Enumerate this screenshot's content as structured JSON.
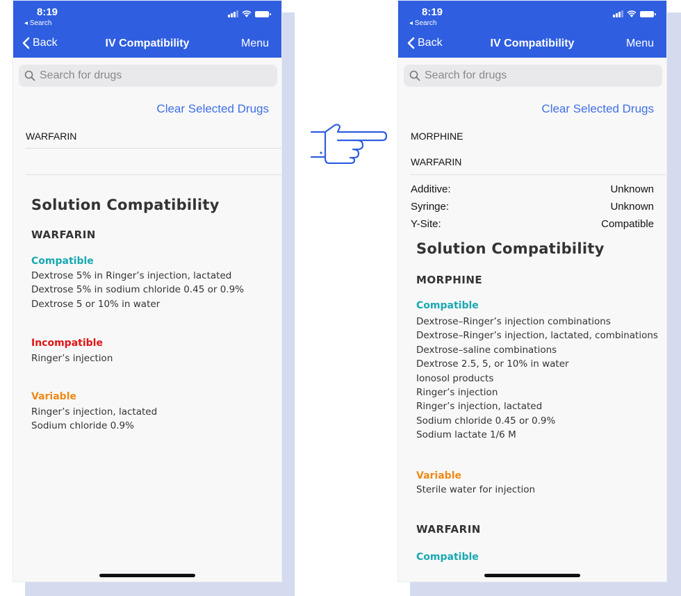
{
  "status": {
    "time": "8:19",
    "back_app": "◂ Search"
  },
  "nav": {
    "back_label": "Back",
    "title": "IV Compatibility",
    "menu_label": "Menu"
  },
  "search": {
    "placeholder": "Search for drugs"
  },
  "clear_label": "Clear Selected Drugs",
  "colors": {
    "header": "#2f5ee0",
    "compatible": "#18a8b2",
    "incompatible": "#e01515",
    "variable": "#ee8a17",
    "link": "#3f6fe6"
  },
  "left": {
    "selected_drugs": [
      "WARFARIN"
    ],
    "heading": "Solution Compatibility",
    "drug_name": "WARFARIN",
    "compatible_label": "Compatible",
    "compatible_items": [
      "Dextrose 5% in Ringer’s injection, lactated",
      "Dextrose 5% in sodium chloride 0.45 or 0.9%",
      "Dextrose 5 or 10% in water"
    ],
    "incompatible_label": "Incompatible",
    "incompatible_items": [
      "Ringer’s injection"
    ],
    "variable_label": "Variable",
    "variable_items": [
      "Ringer’s injection, lactated",
      "Sodium chloride 0.9%"
    ]
  },
  "right": {
    "selected_drugs": [
      "MORPHINE",
      "WARFARIN"
    ],
    "kv": [
      {
        "k": "Additive:",
        "v": "Unknown"
      },
      {
        "k": "Syringe:",
        "v": "Unknown"
      },
      {
        "k": "Y-Site:",
        "v": "Compatible"
      }
    ],
    "heading": "Solution Compatibility",
    "drug1": "MORPHINE",
    "compatible_label": "Compatible",
    "compatible_items": [
      "Dextrose–Ringer’s injection combinations",
      "Dextrose–Ringer’s injection, lactated, combinations",
      "Dextrose–saline combinations",
      "Dextrose 2.5, 5, or 10% in water",
      "Ionosol products",
      "Ringer’s injection",
      "Ringer’s injection, lactated",
      "Sodium chloride 0.45 or 0.9%",
      "Sodium lactate 1/6 M"
    ],
    "variable_label": "Variable",
    "variable_items": [
      "Sterile water for injection"
    ],
    "drug2": "WARFARIN",
    "compatible2_label": "Compatible"
  }
}
